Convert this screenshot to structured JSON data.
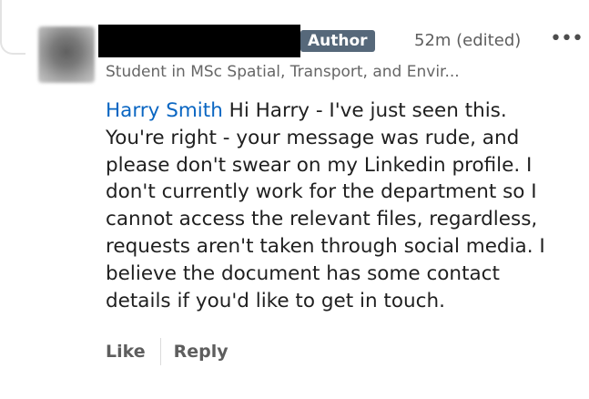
{
  "comment": {
    "badge": "Author",
    "timestamp": "52m (edited)",
    "more_icon": "more-horizontal-icon",
    "more_glyph": "•••",
    "headline": "Student in MSc Spatial, Transport, and Envir...",
    "mention": "Harry Smith",
    "text_lines": [
      " Hi Harry - I've just seen this.",
      "You're right - your message was rude, and",
      "please don't swear on my Linkedin profile. I",
      "don't currently work for the department so I",
      "cannot access the relevant files, regardless,",
      "requests aren't taken through social media. I",
      "believe the document has some contact",
      "details if you'd like to get in touch."
    ]
  },
  "actions": {
    "like_label": "Like",
    "reply_label": "Reply"
  },
  "colors": {
    "mention": "#0a66c2",
    "badge_bg": "#56687a",
    "meta_text": "#5e5e5e"
  }
}
